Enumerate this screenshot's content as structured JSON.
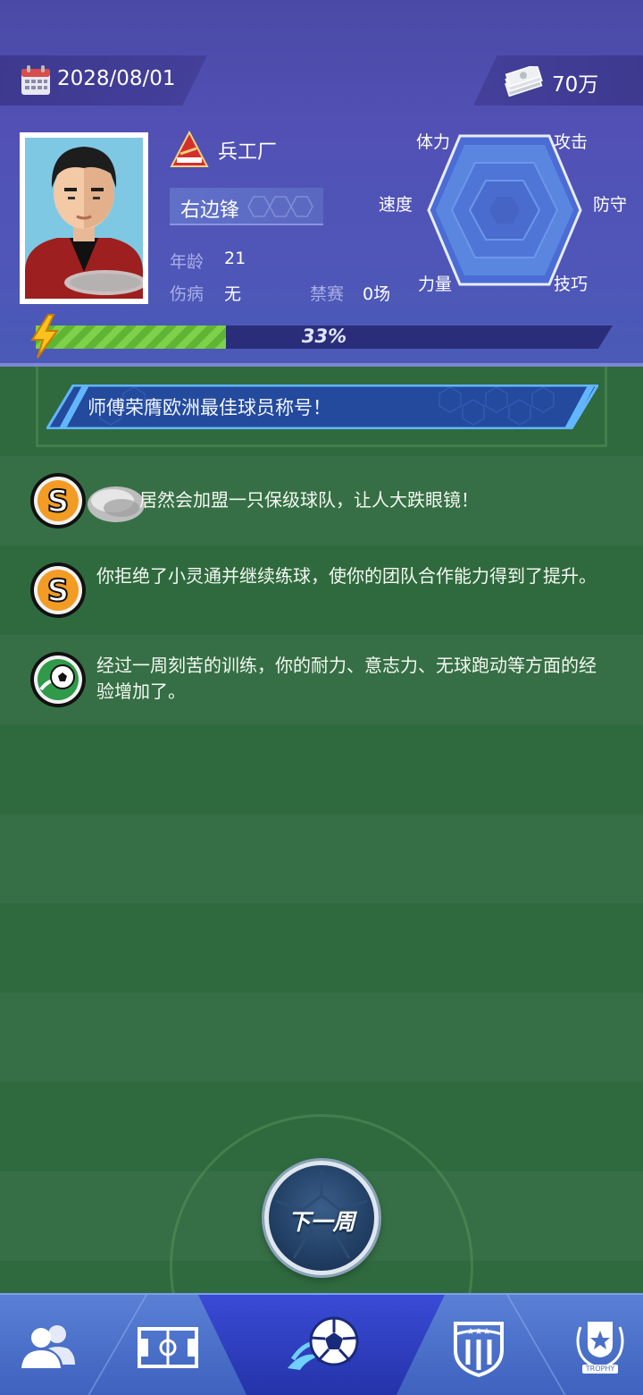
{
  "header": {
    "date": "2028/08/01",
    "money": "70万",
    "club": {
      "name": "兵工厂",
      "badge_text": "Arsenal"
    },
    "position": "右边锋",
    "info": {
      "age_label": "年龄",
      "age_value": "21",
      "injury_label": "伤病",
      "injury_value": "无",
      "ban_label": "禁赛",
      "ban_value": "0场"
    },
    "radar": {
      "labels": [
        "体力",
        "攻击",
        "防守",
        "技巧",
        "力量",
        "速度"
      ]
    },
    "progress": {
      "percent": 33,
      "text": "33%"
    }
  },
  "banner": {
    "text": "师傅荣膺欧洲最佳球员称号！"
  },
  "news": [
    {
      "icon": "s-coin-icon",
      "text": "居然会加盟一只保级球队，让人大跌眼镜！"
    },
    {
      "icon": "s-coin-icon",
      "text": "你拒绝了小灵通并继续练球，使你的团队合作能力得到了提升。"
    },
    {
      "icon": "soccer-ball-icon",
      "text": "经过一周刻苦的训练，你的耐力、意志力、无球跑动等方面的经验增加了。"
    }
  ],
  "next_button": {
    "label": "下一周"
  },
  "nav": {
    "items": [
      "team-icon",
      "pitch-icon",
      "match-icon",
      "club-crest-icon",
      "trophy-icon"
    ],
    "active": 2,
    "trophy_text": "TROPHY"
  },
  "colors": {
    "header": "#5250b4",
    "field": "#2f6a3e",
    "progress_fill": "#7fd04a",
    "nav": "#4a70c8"
  }
}
